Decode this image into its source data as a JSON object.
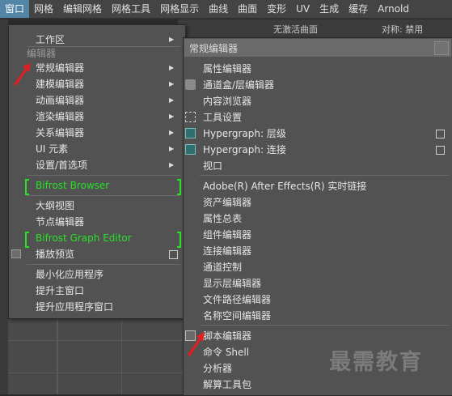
{
  "menubar": {
    "items": [
      "窗口",
      "网格",
      "编辑网格",
      "网格工具",
      "网格显示",
      "曲线",
      "曲面",
      "变形",
      "UV",
      "生成",
      "缓存",
      "Arnold"
    ],
    "active_index": 0
  },
  "shelf": {
    "visible_text_1": "无激活曲面",
    "visible_text_2": "对称: 禁用"
  },
  "window_menu": {
    "workspace": "工作区",
    "section_editors": "编辑器",
    "general_editors": "常规编辑器",
    "modeling_editors": "建模编辑器",
    "animation_editors": "动画编辑器",
    "rendering_editors": "渲染编辑器",
    "relationship_editors": "关系编辑器",
    "ui_elements": "UI 元素",
    "settings_prefs": "设置/首选项",
    "bifrost_browser": "Bifrost Browser",
    "outliner": "大纲视图",
    "node_editor": "节点编辑器",
    "bifrost_graph_editor": "Bifrost Graph Editor",
    "playblast": "播放预览",
    "minimize_app": "最小化应用程序",
    "raise_main_window": "提升主窗口",
    "raise_app_windows": "提升应用程序窗口"
  },
  "submenu": {
    "tearoff_title": "常规编辑器",
    "attribute_editor": "属性编辑器",
    "channel_box": "通道盒/层编辑器",
    "content_browser": "内容浏览器",
    "tool_settings": "工具设置",
    "hypergraph_hierarchy": "Hypergraph: 层级",
    "hypergraph_connections": "Hypergraph: 连接",
    "viewport": "视口",
    "after_effects_link": "Adobe(R) After Effects(R) 实时链接",
    "asset_editor": "资产编辑器",
    "attribute_spreadsheet": "属性总表",
    "component_editor": "组件编辑器",
    "connection_editor": "连接编辑器",
    "channel_control": "通道控制",
    "display_layer_editor": "显示层编辑器",
    "file_path_editor": "文件路径编辑器",
    "namespace_editor": "名称空间编辑器",
    "script_editor": "脚本编辑器",
    "command_shell": "命令 Shell",
    "profiler": "分析器",
    "solver_package": "解算工具包"
  },
  "watermark": "最需教育",
  "colors": {
    "accent": "#5285a6",
    "bifrost_green": "#28e028",
    "pointer_red": "#e02020",
    "menu_bg": "#525252"
  }
}
